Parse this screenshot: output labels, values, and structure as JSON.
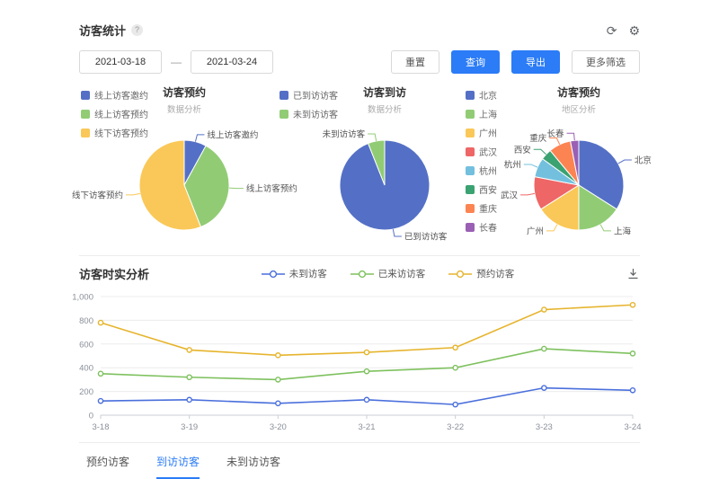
{
  "header": {
    "title": "访客统计",
    "help": "?",
    "refresh_glyph": "⟳",
    "settings_glyph": "⚙"
  },
  "filters": {
    "date_start": "2021-03-18",
    "date_separator": "—",
    "date_end": "2021-03-24",
    "buttons": [
      {
        "label": "重置",
        "style": "default"
      },
      {
        "label": "查询",
        "style": "primary"
      },
      {
        "label": "导出",
        "style": "primary"
      },
      {
        "label": "更多筛选",
        "style": "default"
      }
    ]
  },
  "colors": {
    "primary_button": "#2b7cf6",
    "active_tab": "#2b7cf6"
  },
  "chart_data": [
    {
      "type": "pie",
      "title": "访客预约",
      "subtitle": "数据分析",
      "legend_position": "top-left",
      "slices": [
        {
          "label": "线上访客邀约",
          "value": 8,
          "color": "#5470c6"
        },
        {
          "label": "线上访客预约",
          "value": 36,
          "color": "#91cc75"
        },
        {
          "label": "线下访客预约",
          "value": 56,
          "color": "#fac858"
        }
      ]
    },
    {
      "type": "pie",
      "title": "访客到访",
      "subtitle": "数据分析",
      "legend_position": "top-left",
      "slices": [
        {
          "label": "已到访访客",
          "value": 94,
          "color": "#5470c6"
        },
        {
          "label": "未到访访客",
          "value": 6,
          "color": "#91cc75"
        }
      ]
    },
    {
      "type": "pie",
      "title": "访客预约",
      "subtitle": "地区分析",
      "legend_position": "left",
      "slices": [
        {
          "label": "北京",
          "value": 34,
          "color": "#5470c6"
        },
        {
          "label": "上海",
          "value": 16,
          "color": "#91cc75"
        },
        {
          "label": "广州",
          "value": 16,
          "color": "#fac858"
        },
        {
          "label": "武汉",
          "value": 12,
          "color": "#ee6666"
        },
        {
          "label": "杭州",
          "value": 7,
          "color": "#73c0de"
        },
        {
          "label": "西安",
          "value": 4,
          "color": "#3ba272"
        },
        {
          "label": "重庆",
          "value": 8,
          "color": "#fc8452"
        },
        {
          "label": "长春",
          "value": 3,
          "color": "#9a60b4"
        }
      ]
    },
    {
      "type": "line",
      "title": "访客时实分析",
      "x": [
        "3-18",
        "3-19",
        "3-20",
        "3-21",
        "3-22",
        "3-23",
        "3-24"
      ],
      "ylim": [
        0,
        1000
      ],
      "yticks": [
        "0",
        "200",
        "400",
        "600",
        "800",
        "1,000"
      ],
      "grid": true,
      "legend_position": "top-center",
      "series": [
        {
          "name": "未到访客",
          "color": "#4a6fdc",
          "values": [
            120,
            130,
            100,
            130,
            90,
            230,
            210
          ]
        },
        {
          "name": "已来访访客",
          "color": "#7ec15e",
          "values": [
            350,
            320,
            300,
            370,
            400,
            560,
            520
          ]
        },
        {
          "name": "预约访客",
          "color": "#e6b42c",
          "values": [
            780,
            550,
            505,
            530,
            570,
            890,
            930
          ]
        }
      ]
    }
  ],
  "tabs": [
    {
      "label": "预约访客",
      "active": false
    },
    {
      "label": "到访访客",
      "active": true
    },
    {
      "label": "未到访访客",
      "active": false
    }
  ]
}
